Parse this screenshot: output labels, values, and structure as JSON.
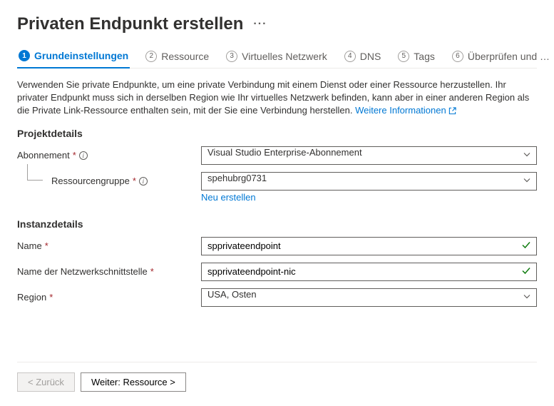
{
  "pageTitle": "Privaten Endpunkt erstellen",
  "tabs": [
    {
      "num": "1",
      "label": "Grundeinstellungen",
      "active": true
    },
    {
      "num": "2",
      "label": "Ressource"
    },
    {
      "num": "3",
      "label": "Virtuelles Netzwerk"
    },
    {
      "num": "4",
      "label": "DNS"
    },
    {
      "num": "5",
      "label": "Tags"
    },
    {
      "num": "6",
      "label": "Überprüfen und e…"
    }
  ],
  "description": "Verwenden Sie private Endpunkte, um eine private Verbindung mit einem Dienst oder einer Ressource herzustellen. Ihr privater Endpunkt muss sich in derselben Region wie Ihr virtuelles Netzwerk befinden, kann aber in einer anderen Region als die Private Link-Ressource enthalten sein, mit der Sie eine Verbindung herstellen.",
  "learnMore": "Weitere Informationen",
  "sections": {
    "project": {
      "header": "Projektdetails",
      "subscription": {
        "label": "Abonnement",
        "value": "Visual Studio Enterprise-Abonnement"
      },
      "resourceGroup": {
        "label": "Ressourcengruppe",
        "value": "spehubrg0731",
        "createNew": "Neu erstellen"
      }
    },
    "instance": {
      "header": "Instanzdetails",
      "name": {
        "label": "Name",
        "value": "spprivateendpoint"
      },
      "nicName": {
        "label": "Name der Netzwerkschnittstelle",
        "value": "spprivateendpoint-nic"
      },
      "region": {
        "label": "Region",
        "value": "USA, Osten"
      }
    }
  },
  "footer": {
    "back": "< Zurück",
    "next": "Weiter: Ressource >"
  }
}
